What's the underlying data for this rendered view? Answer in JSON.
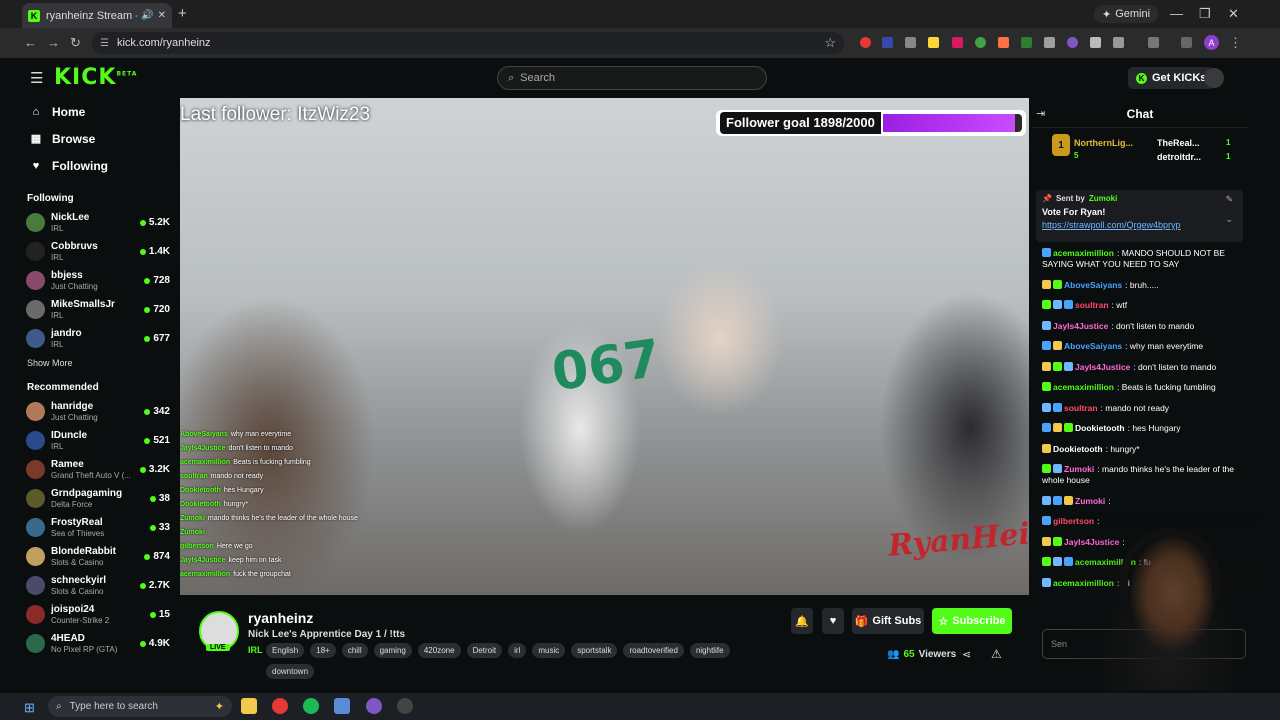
{
  "browser": {
    "tab_title": "ryanheinz Stream - Watch L",
    "new_tab": "+",
    "gemini_label": "Gemini",
    "url": "kick.com/ryanheinz",
    "profile_initial": "A"
  },
  "kick_header": {
    "logo": "KICK",
    "logo_sup": "BETA",
    "search_placeholder": "Search",
    "get_kicks": "Get KICKs"
  },
  "sidebar": {
    "nav": [
      {
        "label": "Home",
        "icon": "home-icon"
      },
      {
        "label": "Browse",
        "icon": "browse-icon"
      },
      {
        "label": "Following",
        "icon": "heart-icon"
      }
    ],
    "following_title": "Following",
    "following": [
      {
        "name": "NickLee",
        "category": "IRL",
        "viewers": "5.2K",
        "color": "#4a7a3c"
      },
      {
        "name": "Cobbruvs",
        "category": "IRL",
        "viewers": "1.4K",
        "color": "#222"
      },
      {
        "name": "bbjess",
        "category": "Just Chatting",
        "viewers": "728",
        "color": "#8a4a6c"
      },
      {
        "name": "MikeSmallsJr",
        "category": "IRL",
        "viewers": "720",
        "color": "#6a6a6a"
      },
      {
        "name": "jandro",
        "category": "IRL",
        "viewers": "677",
        "color": "#3c5a8a"
      }
    ],
    "show_more": "Show More",
    "recommended_title": "Recommended",
    "recommended": [
      {
        "name": "hanridge",
        "category": "Just Chatting",
        "viewers": "342",
        "color": "#b07a5a"
      },
      {
        "name": "IDuncle",
        "category": "IRL",
        "viewers": "521",
        "color": "#2a4a8a"
      },
      {
        "name": "Ramee",
        "category": "Grand Theft Auto V (...",
        "viewers": "3.2K",
        "color": "#7a3a2a"
      },
      {
        "name": "Grndpagaming",
        "category": "Delta Force",
        "viewers": "38",
        "color": "#5a5a2a"
      },
      {
        "name": "FrostyReal",
        "category": "Sea of Thieves",
        "viewers": "33",
        "color": "#3a6a8a"
      },
      {
        "name": "BlondeRabbit",
        "category": "Slots & Casino",
        "viewers": "874",
        "color": "#c0a060"
      },
      {
        "name": "schneckyirl",
        "category": "Slots & Casino",
        "viewers": "2.7K",
        "color": "#4a4a6a"
      },
      {
        "name": "joispoi24",
        "category": "Counter-Strike 2",
        "viewers": "15",
        "color": "#8a2a2a"
      },
      {
        "name": "4HEAD",
        "category": "No Pixel RP (GTA)",
        "viewers": "4.9K",
        "color": "#2a6a4a"
      }
    ]
  },
  "video": {
    "last_follower": "Last follower: ItzWiz23",
    "goal_label": "Follower goal 1898/2000",
    "goal_progress": 0.949,
    "jersey": "067",
    "watermark": "RyanHeinz",
    "overlay_chat": [
      {
        "user": "AboveSaiyans",
        "text": "why man everytime"
      },
      {
        "user": "JayIs4Justice",
        "text": "don't listen to mando"
      },
      {
        "user": "acemaximillion",
        "text": "Beats is fucking fumbling"
      },
      {
        "user": "soultran",
        "text": "mando not ready"
      },
      {
        "user": "Dookietooth",
        "text": "hes Hungary"
      },
      {
        "user": "Dookietooth",
        "text": "hungry*"
      },
      {
        "user": "Zumoki",
        "text": "mando thinks he's the leader of the whole house"
      },
      {
        "user": "Zumoki",
        "text": ""
      },
      {
        "user": "gilbertson",
        "text": "Here we go"
      },
      {
        "user": "JayIs4Justice",
        "text": "keep him on task"
      },
      {
        "user": "acemaximillion",
        "text": "fuck the groupchat"
      }
    ]
  },
  "stream": {
    "channel": "ryanheinz",
    "title": "Nick Lee's Apprentice Day 1 / !tts",
    "live_badge": "LIVE",
    "category": "IRL",
    "tags": [
      "English",
      "18+",
      "chill",
      "gaming",
      "420zone",
      "Detroit",
      "irl",
      "music",
      "sportstalk",
      "roadtoverified",
      "nightlife",
      "downtown"
    ],
    "gift_subs": "Gift Subs",
    "subscribe": "Subscribe",
    "viewer_count": "65",
    "viewers_label": "Viewers"
  },
  "chat": {
    "title": "Chat",
    "top_gifter_rank": "1",
    "gifters": [
      {
        "name": "NorthernLig...",
        "count": "5"
      },
      {
        "name": "TheReal...",
        "count": "1"
      },
      {
        "name": "detroitdr...",
        "count": "1"
      }
    ],
    "pinned_sent_by": "Sent by",
    "pinned_user": "Zumoki",
    "pinned_title": "Vote For Ryan!",
    "pinned_link": "https://strawpoll.com/Qrgew4bpryp",
    "messages": [
      {
        "user": "acemaximillion",
        "color": "#53fc18",
        "text": "MANDO SHOULD NOT BE SAYING WHAT YOU NEED TO SAY"
      },
      {
        "user": "AboveSaiyans",
        "color": "#4aa3ff",
        "text": "bruh....."
      },
      {
        "user": "soultran",
        "color": "#ff4a6a",
        "text": "wtf"
      },
      {
        "user": "JayIs4Justice",
        "color": "#ff6ad5",
        "text": "don't listen to mando"
      },
      {
        "user": "AboveSaiyans",
        "color": "#4aa3ff",
        "text": "why man everytime"
      },
      {
        "user": "JayIs4Justice",
        "color": "#ff6ad5",
        "text": "don't listen to mando"
      },
      {
        "user": "acemaximillion",
        "color": "#53fc18",
        "text": "Beats is fucking fumbling"
      },
      {
        "user": "soultran",
        "color": "#ff4a6a",
        "text": "mando not ready"
      },
      {
        "user": "Dookietooth",
        "color": "#ffffff",
        "text": "hes Hungary"
      },
      {
        "user": "Dookietooth",
        "color": "#ffffff",
        "text": "hungry*"
      },
      {
        "user": "Zumoki",
        "color": "#ff6ad5",
        "text": "mando thinks he's the leader of the whole house"
      },
      {
        "user": "Zumoki",
        "color": "#ff6ad5",
        "text": ""
      },
      {
        "user": "gilbertson",
        "color": "#ff4a6a",
        "text": ""
      },
      {
        "user": "JayIs4Justice",
        "color": "#ff6ad5",
        "text": ""
      },
      {
        "user": "acemaximillion",
        "color": "#53fc18",
        "text": "fu"
      },
      {
        "user": "acemaximillion",
        "color": "#53fc18",
        "text": "wi"
      }
    ],
    "input_placeholder": "Sen"
  },
  "taskbar": {
    "search_placeholder": "Type here to search"
  }
}
